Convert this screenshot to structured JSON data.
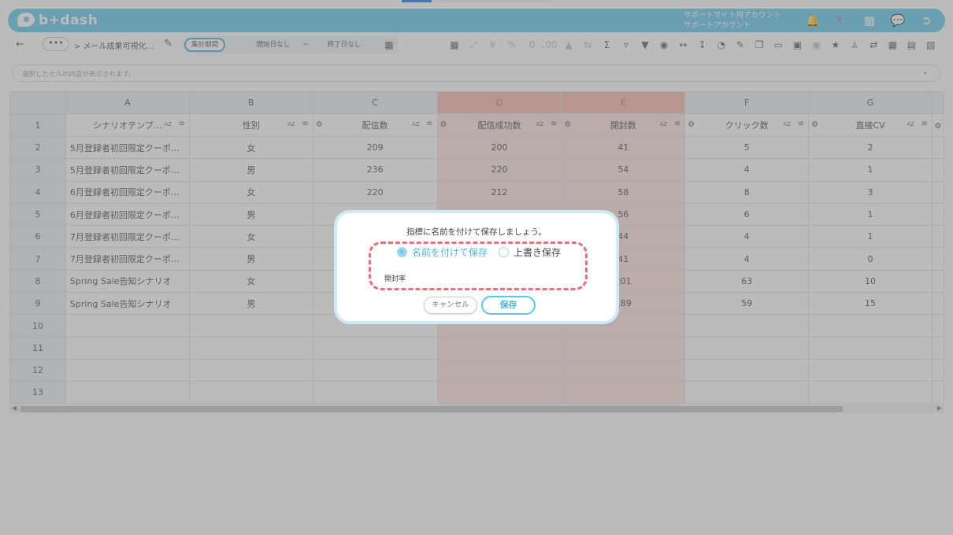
{
  "app": {
    "logo": "b+dash"
  },
  "header": {
    "account_line1": "サポートサイト用アカウント",
    "account_line2": "サポートアカウント",
    "icons": [
      "bell-icon",
      "wrench-icon",
      "apps-grid-icon",
      "chat-icon",
      "logout-icon"
    ]
  },
  "toolbar": {
    "back": "←",
    "more": "•••",
    "breadcrumb": "> メール成果可視化…",
    "period_label": "集計期間",
    "start_date": "開始日なし",
    "tilde": "~",
    "end_date": "終了日なし",
    "icons": [
      "table-icon",
      "move-icon",
      "yen-icon",
      "percent-icon",
      "decimal-icon",
      "decimal-add-icon",
      "font-size-icon",
      "text-direction-icon",
      "sigma-icon",
      "filter-add-icon",
      "filter-icon",
      "eye-icon",
      "code-icon",
      "download-icon",
      "chart-icon",
      "edit-icon",
      "copy-icon",
      "trash-icon",
      "archive-icon",
      "disabled-icon",
      "star-icon",
      "share-icon",
      "swap-icon",
      "calendar-icon",
      "document-icon",
      "clipboard-icon"
    ]
  },
  "formula_bar": {
    "placeholder": "選択したセルの内容が表示されます。"
  },
  "grid": {
    "columns": [
      "A",
      "B",
      "C",
      "D",
      "E",
      "F",
      "G"
    ],
    "fields": [
      "シナリオテンプ…",
      "性別",
      "配信数",
      "配信成功数",
      "開封数",
      "クリック数",
      "直接CV"
    ],
    "rows": [
      {
        "n": "2",
        "a": "5月登録者初回限定クーポ…",
        "b": "女",
        "c": "209",
        "d": "200",
        "e": "41",
        "f": "5",
        "g": "2"
      },
      {
        "n": "3",
        "a": "5月登録者初回限定クーポ…",
        "b": "男",
        "c": "236",
        "d": "220",
        "e": "54",
        "f": "4",
        "g": "1"
      },
      {
        "n": "4",
        "a": "6月登録者初回限定クーポ…",
        "b": "女",
        "c": "220",
        "d": "212",
        "e": "58",
        "f": "8",
        "g": "3"
      },
      {
        "n": "5",
        "a": "6月登録者初回限定クーポ…",
        "b": "男",
        "c": "",
        "d": "",
        "e": "56",
        "f": "6",
        "g": "1"
      },
      {
        "n": "6",
        "a": "7月登録者初回限定クーポ…",
        "b": "女",
        "c": "",
        "d": "",
        "e": "44",
        "f": "4",
        "g": "1"
      },
      {
        "n": "7",
        "a": "7月登録者初回限定クーポ…",
        "b": "男",
        "c": "",
        "d": "",
        "e": "41",
        "f": "4",
        "g": "0"
      },
      {
        "n": "8",
        "a": "Spring Sale告知シナリオ",
        "b": "女",
        "c": "",
        "d": "",
        "e": "201",
        "f": "63",
        "g": "10"
      },
      {
        "n": "9",
        "a": "Spring Sale告知シナリオ",
        "b": "男",
        "c": "",
        "d": "",
        "e": "189",
        "f": "59",
        "g": "15"
      },
      {
        "n": "10",
        "a": "",
        "b": "",
        "c": "",
        "d": "",
        "e": "",
        "f": "",
        "g": ""
      },
      {
        "n": "11",
        "a": "",
        "b": "",
        "c": "",
        "d": "",
        "e": "",
        "f": "",
        "g": ""
      },
      {
        "n": "12",
        "a": "",
        "b": "",
        "c": "",
        "d": "",
        "e": "",
        "f": "",
        "g": ""
      },
      {
        "n": "13",
        "a": "",
        "b": "",
        "c": "",
        "d": "",
        "e": "",
        "f": "",
        "g": ""
      }
    ],
    "header_row_number": "1",
    "az": "AZ"
  },
  "dialog": {
    "title": "指標に名前を付けて保存しましょう。",
    "option_save_as": "名前を付けて保存",
    "option_overwrite": "上書き保存",
    "name_value": "開封率",
    "cancel": "キャンセル",
    "save": "保存"
  }
}
